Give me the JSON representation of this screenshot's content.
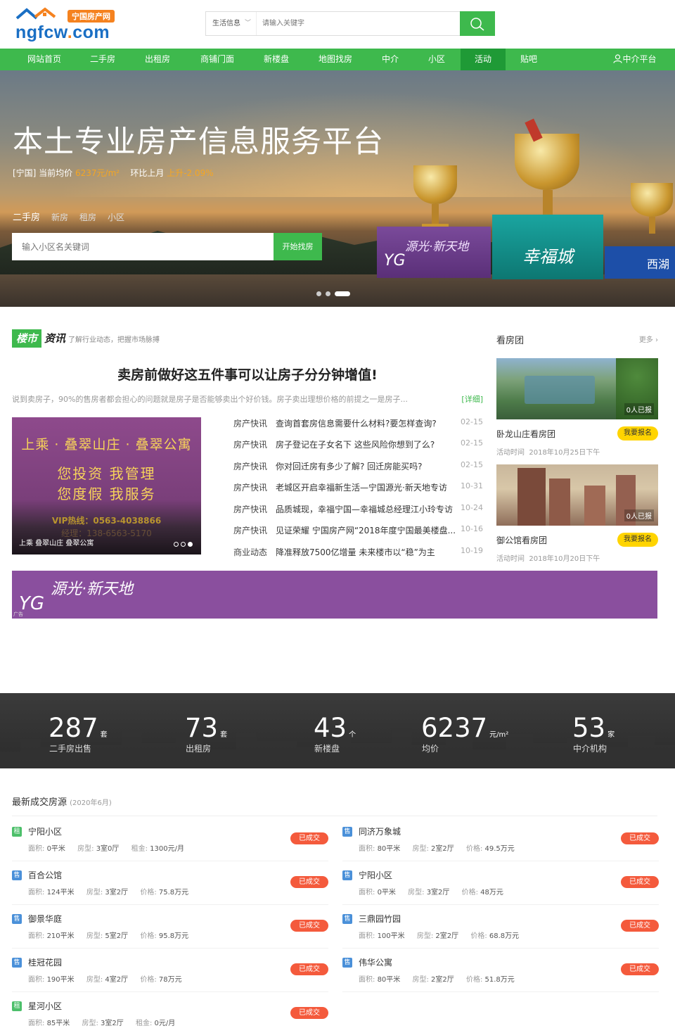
{
  "header": {
    "logo_tag": "宁国房产网",
    "logo_name": "ngfcw",
    "logo_dot": ".",
    "logo_tld": "com",
    "search_category": "生活信息",
    "search_placeholder": "请输入关键字"
  },
  "nav": {
    "items": [
      "网站首页",
      "二手房",
      "出租房",
      "商铺门面",
      "新楼盘",
      "地图找房",
      "中介",
      "小区",
      "活动",
      "贴吧"
    ],
    "active": "活动",
    "agent_platform": "中介平台"
  },
  "banner": {
    "title": "本土专业房产信息服务平台",
    "price_prefix": "[宁国] 当前均价",
    "price_value": "6237元/m²",
    "change_prefix": "环比上月",
    "change_value": "上升-2.09%",
    "tabs": [
      "二手房",
      "新房",
      "租房",
      "小区"
    ],
    "search_placeholder": "输入小区名关键词",
    "search_button": "开始找房",
    "panels": [
      "源光·新天地",
      "幸福城",
      "西湖"
    ]
  },
  "news": {
    "section_tag": "楼市",
    "section_title": "资讯",
    "section_sub": "了解行业动态，把握市场脉搏",
    "headline": "卖房前做好这五件事可以让房子分分钟增值!",
    "summary": "说到卖房子，90%的售房者都会担心的问题就是房子是否能够卖出个好价钱。房子卖出理想价格的前提之一是房子...",
    "summary_more": "[详细]",
    "promo": {
      "line1": "上乘 · 叠翠山庄 · 叠翠公寓",
      "line2": "您投资 我管理",
      "line3": "您度假 我服务",
      "line4": "VIP热线：0563-4038866",
      "line5": "经理：138-6563-5170",
      "caption": "上乘 叠翠山庄 叠翠公寓"
    },
    "items": [
      {
        "cat": "房产快讯",
        "title": "查询首套房信息需要什么材料?要怎样查询?",
        "date": "02-15"
      },
      {
        "cat": "房产快讯",
        "title": "房子登记在子女名下 这些风险你想到了么?",
        "date": "02-15"
      },
      {
        "cat": "房产快讯",
        "title": "你对回迁房有多少了解? 回迁房能买吗?",
        "date": "02-15"
      },
      {
        "cat": "房产快讯",
        "title": "老城区开启幸福新生活—宁国源光·新天地专访",
        "date": "10-31"
      },
      {
        "cat": "房产快讯",
        "title": "品质城现，幸福宁国—幸福城总经理江小玲专访",
        "date": "10-24"
      },
      {
        "cat": "房产快讯",
        "title": "见证荣耀 宁国房产网“2018年度宁国最美楼盘...",
        "date": "10-16"
      },
      {
        "cat": "商业动态",
        "title": "降准释放7500亿增量 未来楼市以“稳”为主",
        "date": "10-19"
      }
    ]
  },
  "tour": {
    "title": "看房团",
    "more": "更多",
    "cards": [
      {
        "count": "0人已报",
        "name": "卧龙山庄看房团",
        "button": "我要报名",
        "time_label": "活动时间",
        "time": "2018年10月25日下午"
      },
      {
        "count": "0人已报",
        "name": "御公馆看房团",
        "button": "我要报名",
        "time_label": "活动时间",
        "time": "2018年10月20日下午"
      }
    ]
  },
  "ad": {
    "brand": "源光·新天地",
    "label": "广告"
  },
  "stats": [
    {
      "value": "287",
      "unit": "套",
      "label": "二手房出售"
    },
    {
      "value": "73",
      "unit": "套",
      "label": "出租房"
    },
    {
      "value": "43",
      "unit": "个",
      "label": "新楼盘"
    },
    {
      "value": "6237",
      "unit": "元/m²",
      "label": "均价"
    },
    {
      "value": "53",
      "unit": "家",
      "label": "中介机构"
    }
  ],
  "deals": {
    "title": "最新成交房源",
    "subtitle": "(2020年6月)",
    "status": "已成交",
    "items": [
      {
        "type": "租",
        "name": "宁阳小区",
        "area_label": "面积:",
        "area": "0平米",
        "layout_label": "房型:",
        "layout": "3室0厅",
        "price_label": "租金:",
        "price": "1300元/月"
      },
      {
        "type": "售",
        "name": "同济万象城",
        "area_label": "面积:",
        "area": "80平米",
        "layout_label": "房型:",
        "layout": "2室2厅",
        "price_label": "价格:",
        "price": "49.5万元"
      },
      {
        "type": "售",
        "name": "百合公馆",
        "area_label": "面积:",
        "area": "124平米",
        "layout_label": "房型:",
        "layout": "3室2厅",
        "price_label": "价格:",
        "price": "75.8万元"
      },
      {
        "type": "售",
        "name": "宁阳小区",
        "area_label": "面积:",
        "area": "0平米",
        "layout_label": "房型:",
        "layout": "3室2厅",
        "price_label": "价格:",
        "price": "48万元"
      },
      {
        "type": "售",
        "name": "御景华庭",
        "area_label": "面积:",
        "area": "210平米",
        "layout_label": "房型:",
        "layout": "5室2厅",
        "price_label": "价格:",
        "price": "95.8万元"
      },
      {
        "type": "售",
        "name": "三鼎园竹园",
        "area_label": "面积:",
        "area": "100平米",
        "layout_label": "房型:",
        "layout": "2室2厅",
        "price_label": "价格:",
        "price": "68.8万元"
      },
      {
        "type": "售",
        "name": "桂冠花园",
        "area_label": "面积:",
        "area": "190平米",
        "layout_label": "房型:",
        "layout": "4室2厅",
        "price_label": "价格:",
        "price": "78万元"
      },
      {
        "type": "售",
        "name": "伟华公寓",
        "area_label": "面积:",
        "area": "80平米",
        "layout_label": "房型:",
        "layout": "2室2厅",
        "price_label": "价格:",
        "price": "51.8万元"
      },
      {
        "type": "租",
        "name": "星河小区",
        "area_label": "面积:",
        "area": "85平米",
        "layout_label": "房型:",
        "layout": "3室2厅",
        "price_label": "租金:",
        "price": "0元/月"
      }
    ]
  },
  "colors": {
    "brand_green": "#3eb94d",
    "accent_orange": "#f5821f",
    "logo_blue": "#1a6fc4",
    "status_red": "#f45a3c"
  }
}
